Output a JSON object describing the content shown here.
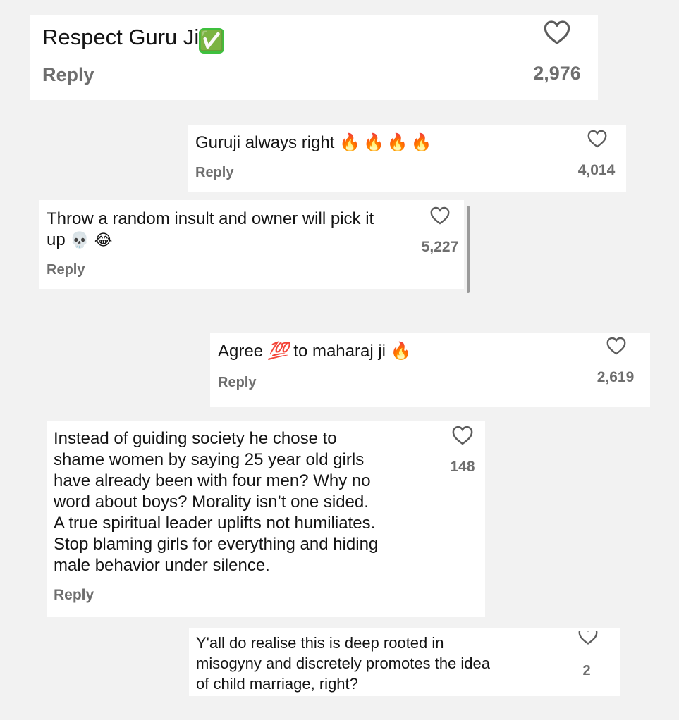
{
  "comments": [
    {
      "text": "Respect Guru Ji",
      "emoji": "✅",
      "reply_label": "Reply",
      "like_count": "2,976"
    },
    {
      "text": "Guruji always right ",
      "emoji": "🔥🔥🔥🔥",
      "reply_label": "Reply",
      "like_count": "4,014"
    },
    {
      "text_line1": "Throw a random insult and owner will pick it",
      "text_line2": "up ",
      "emoji": "💀 😂",
      "reply_label": "Reply",
      "like_count": "5,227"
    },
    {
      "text_a": "Agree ",
      "emoji_mid": "💯",
      "text_b": " to maharaj ji ",
      "emoji_end": "🔥",
      "reply_label": "Reply",
      "like_count": "2,619"
    },
    {
      "lines": [
        "Instead of guiding society he chose to",
        "shame women by saying 25 year old girls",
        "have already been with four men? Why no",
        "word about boys? Morality isn’t one sided.",
        "A true spiritual leader uplifts not humiliates.",
        "Stop blaming girls for everything and hiding",
        "male behavior under silence."
      ],
      "reply_label": "Reply",
      "like_count": "148"
    },
    {
      "lines": [
        "Y'all do realise this is deep rooted in",
        "misogyny and discretely promotes the idea",
        "of child marriage, right?"
      ],
      "like_count": "2"
    }
  ],
  "icons": {
    "like": "heart-outline-icon"
  }
}
